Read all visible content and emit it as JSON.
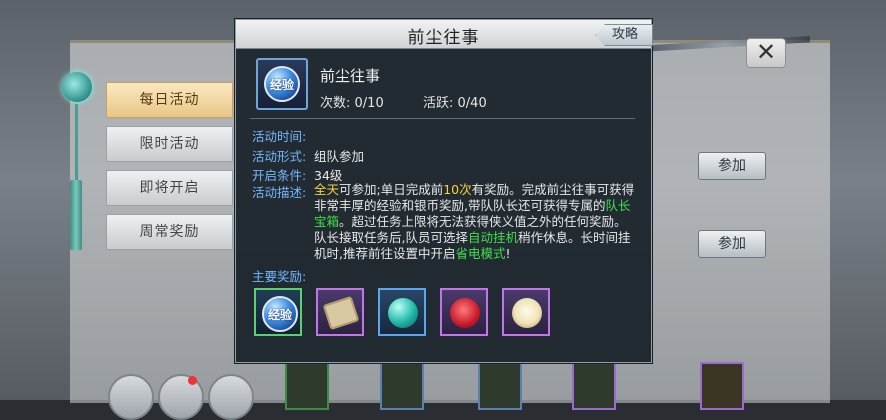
{
  "background": {
    "side_tabs": [
      "每日活动",
      "限时活动",
      "即将开启",
      "周常奖励"
    ],
    "join_buttons": [
      "参加",
      "参加"
    ],
    "close_glyph": "✕"
  },
  "modal": {
    "title": "前尘往事",
    "guide_label": "攻略",
    "activity": {
      "icon_text": "经验",
      "name": "前尘往事",
      "count_label": "次数",
      "count_value": "0/10",
      "activity_label": "活跃",
      "activity_value": "0/40"
    },
    "info": {
      "time_label": "活动时间:",
      "time_value": "",
      "form_label": "活动形式:",
      "form_value": "组队参加",
      "condition_label": "开启条件:",
      "condition_value": "34级",
      "desc_label": "活动描述:",
      "desc_parts": [
        {
          "text": "全天",
          "style": "y"
        },
        {
          "text": "可参加;单日完成前",
          "style": ""
        },
        {
          "text": "10次",
          "style": "y"
        },
        {
          "text": "有奖励。完成前尘往事可获得非常丰厚的经验和银币奖励,带队队长还可获得专属的",
          "style": ""
        },
        {
          "text": "队长宝箱",
          "style": "g"
        },
        {
          "text": "。超过任务上限将无法获得侠义值之外的任何奖励。队长接取任务后,队员可选择",
          "style": ""
        },
        {
          "text": "自动挂机",
          "style": "g"
        },
        {
          "text": "稍作休息。长时间挂机时,推荐前往设置中开启",
          "style": ""
        },
        {
          "text": "省电模式",
          "style": "g"
        },
        {
          "text": "!",
          "style": ""
        }
      ]
    },
    "rewards_label": "主要奖励:",
    "rewards": [
      {
        "icon": "exp-orb-icon",
        "text": "经验",
        "rarity_color": "#5ccf6f"
      },
      {
        "icon": "scroll-icon",
        "text": "",
        "rarity_color": "#c175e6"
      },
      {
        "icon": "jade-orb-icon",
        "text": "",
        "rarity_color": "#5aa7f0"
      },
      {
        "icon": "rose-icon",
        "text": "",
        "rarity_color": "#c175e6"
      },
      {
        "icon": "flower-icon",
        "text": "",
        "rarity_color": "#c175e6"
      }
    ]
  }
}
